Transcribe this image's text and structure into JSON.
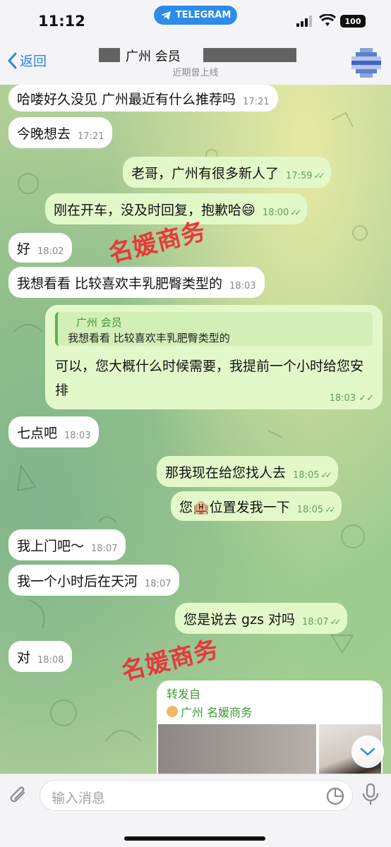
{
  "status_bar": {
    "time": "11:12",
    "app_pill": "TELEGRAM",
    "battery": "100"
  },
  "header": {
    "back_label": "返回",
    "title_fragment": "广州 会员 ",
    "subtitle": "近期曾上线"
  },
  "messages": [
    {
      "dir": "in",
      "text": "哈喽好久没见 广州最近有什么推荐吗",
      "time": "17:21"
    },
    {
      "dir": "in",
      "text": "今晚想去",
      "time": "17:21"
    },
    {
      "dir": "out",
      "text": "老哥，广州有很多新人了",
      "time": "17:59"
    },
    {
      "dir": "out",
      "text": "刚在开车，没及时回复，抱歉哈😄",
      "time": "18:00"
    },
    {
      "dir": "in",
      "text": "好",
      "time": "18:02"
    },
    {
      "dir": "in",
      "text": "我想看看 比较喜欢丰乳肥臀类型的",
      "time": "18:03"
    },
    {
      "dir": "in",
      "text": "七点吧",
      "time": "18:03"
    },
    {
      "dir": "out",
      "text": "那我现在给您找人去",
      "time": "18:05"
    },
    {
      "dir": "out",
      "text": "您🏨位置发我一下",
      "time": "18:05"
    },
    {
      "dir": "in",
      "text": "我上门吧～",
      "time": "18:07"
    },
    {
      "dir": "in",
      "text": "我一个小时后在天河",
      "time": "18:07"
    },
    {
      "dir": "out",
      "text": "您是说去 gzs 对吗",
      "time": "18:07"
    },
    {
      "dir": "in",
      "text": "对",
      "time": "18:08"
    }
  ],
  "reply_message": {
    "quote_name": "广州 会员",
    "quote_text": "我想看看 比较喜欢丰乳肥臀类型的",
    "body": "可以，您大概什么时候需要，我提前一个小时给您安排",
    "time": "18:03"
  },
  "watermark": "名媛商务",
  "forwarded": {
    "label": "转发自",
    "source": "广州 名媛商务"
  },
  "input": {
    "placeholder": "输入消息"
  },
  "colors": {
    "incoming_bubble": "#ffffff",
    "outgoing_bubble": "#e3f8c9",
    "accent_blue": "#2a86e0",
    "green_text": "#3d9a35",
    "watermark_red": "#e33b3b"
  },
  "icons": [
    "telegram-icon",
    "signal-icon",
    "wifi-icon",
    "back-chevron-icon",
    "attach-icon",
    "sticker-icon",
    "mic-icon",
    "chevron-down-icon"
  ]
}
